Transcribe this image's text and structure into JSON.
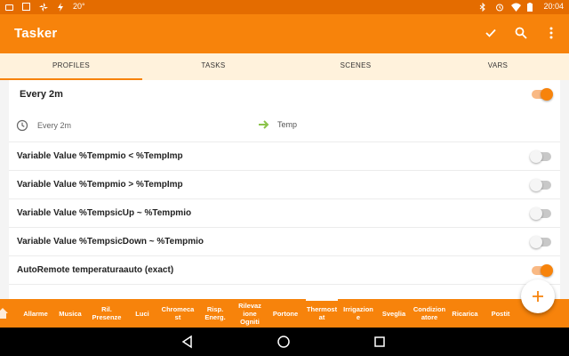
{
  "status_bar": {
    "left_icons": [
      "video-icon",
      "image-icon",
      "fan-icon",
      "bolt-icon"
    ],
    "temperature": "20°",
    "right_icons": [
      "bluetooth-icon",
      "alarm-icon",
      "wifi-icon",
      "battery-icon"
    ],
    "time": "20:04"
  },
  "app_bar": {
    "title": "Tasker",
    "actions": [
      "check-icon",
      "search-icon",
      "more-vert-icon"
    ]
  },
  "tabs": [
    {
      "label": "PROFILES",
      "active": true
    },
    {
      "label": "TASKS",
      "active": false
    },
    {
      "label": "SCENES",
      "active": false
    },
    {
      "label": "VARS",
      "active": false
    }
  ],
  "profile": {
    "name": "Every 2m",
    "enabled": true,
    "trigger": {
      "label": "Every 2m",
      "icon": "clock-icon"
    },
    "task": {
      "label": "Temp",
      "icon": "arrow-right-icon"
    }
  },
  "contexts": [
    {
      "label": "Variable Value  %Tempmio < %TempImp",
      "enabled": false
    },
    {
      "label": "Variable Value  %Tempmio > %TempImp",
      "enabled": false
    },
    {
      "label": "Variable Value  %TempsicUp ~ %Tempmio",
      "enabled": false
    },
    {
      "label": "Variable Value  %TempsicDown ~ %Tempmio",
      "enabled": false
    },
    {
      "label": "AutoRemote temperaturaauto (exact)",
      "enabled": true
    }
  ],
  "fab": {
    "icon": "plus-icon"
  },
  "projects": [
    {
      "label": "Allarme"
    },
    {
      "label": "Musica"
    },
    {
      "label": "Ril.\nPresenze"
    },
    {
      "label": "Luci"
    },
    {
      "label": "Chromeca\nst"
    },
    {
      "label": "Risp.\nEnerg."
    },
    {
      "label": "Rilevaz\nione\nOgniti"
    },
    {
      "label": "Portone"
    },
    {
      "label": "Thermost\nat",
      "active": true
    },
    {
      "label": "Irrigazion\ne"
    },
    {
      "label": "Sveglia"
    },
    {
      "label": "Condizion\natore"
    },
    {
      "label": "Ricarica"
    },
    {
      "label": "Postit"
    }
  ],
  "colors": {
    "status_bar": "#e46c00",
    "primary": "#f7830b",
    "tab_bar": "#fff2dc",
    "accent_green": "#8bc34a"
  }
}
